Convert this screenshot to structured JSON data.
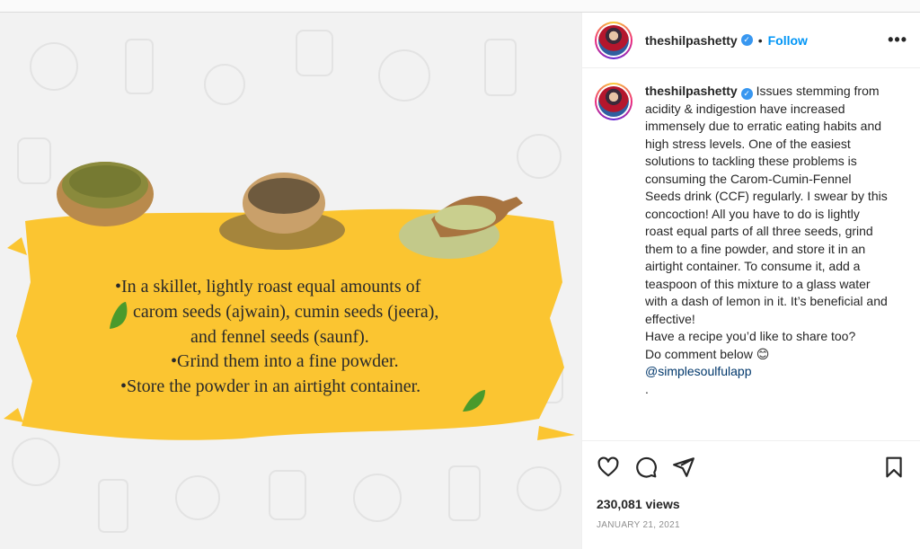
{
  "post": {
    "username": "theshilpashetty",
    "follow_label": "Follow",
    "more_label": "•••",
    "separator": "•"
  },
  "caption": {
    "username": "theshilpashetty",
    "body": "Issues stemming from acidity & indigestion have increased immensely due to erratic eating habits and high stress levels. One of the easiest solutions to tackling these problems is consuming the Carom-Cumin-Fennel Seeds drink (CCF) regularly. I swear by this concoction! All you have to do is lightly roast equal parts of all three seeds, grind them to a fine powder, and store it in an airtight container. To consume it, add a teaspoon of this mixture to a glass water with a dash of lemon in it. It’s beneficial and effective!",
    "line2": "Have a recipe you’d like to share too?",
    "line3": "Do comment below 😊",
    "mention": "@simplesoulfulapp",
    "trailing": "."
  },
  "media": {
    "lines": [
      "•In a skillet, lightly roast equal amounts of",
      "carom seeds (ajwain), cumin seeds (jeera),",
      "and fennel seeds (saunf).",
      "•Grind them into a fine powder.",
      "•Store the powder in an airtight container."
    ]
  },
  "stats": {
    "views": "230,081 views",
    "date": "JANUARY 21, 2021"
  },
  "icons": {
    "like": "heart-icon",
    "comment": "comment-icon",
    "share": "send-icon",
    "save": "bookmark-icon"
  },
  "colors": {
    "accent": "#0095f6",
    "brush": "#fbc531"
  }
}
